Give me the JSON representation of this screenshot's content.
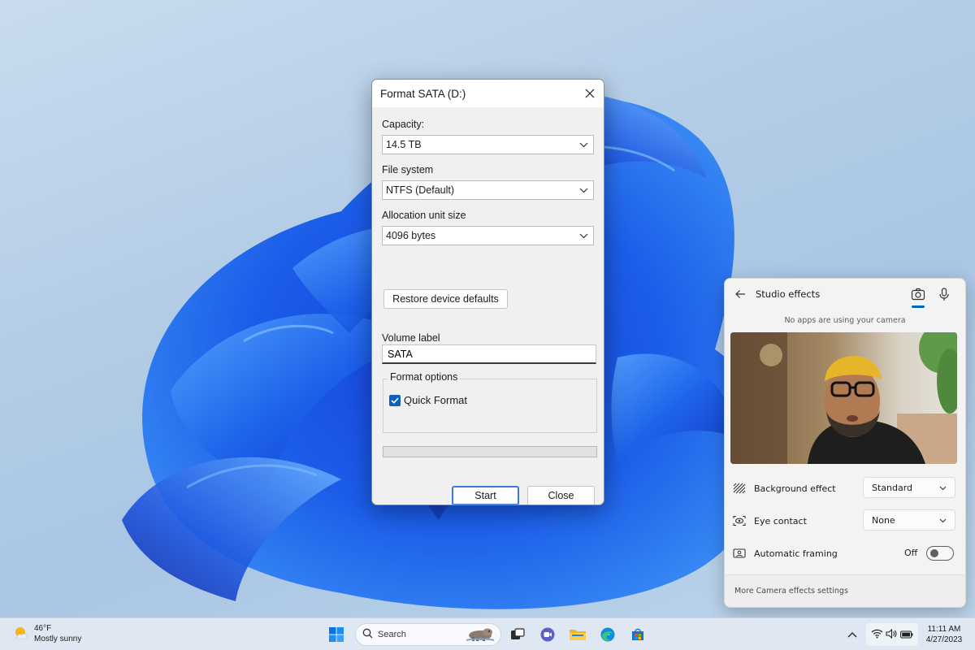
{
  "dialog": {
    "title": "Format SATA (D:)",
    "capacity_label": "Capacity:",
    "capacity_value": "14.5 TB",
    "filesystem_label": "File system",
    "filesystem_value": "NTFS (Default)",
    "allocation_label": "Allocation unit size",
    "allocation_value": "4096 bytes",
    "restore_button": "Restore device defaults",
    "volume_label": "Volume label",
    "volume_value": "SATA",
    "format_options_label": "Format options",
    "quick_format_label": "Quick Format",
    "quick_format_checked": true,
    "progress": 0,
    "start_button": "Start",
    "close_button": "Close"
  },
  "studio_effects": {
    "title": "Studio effects",
    "notice": "No apps are using your camera",
    "rows": [
      {
        "label": "Background effect",
        "value": "Standard"
      },
      {
        "label": "Eye contact",
        "value": "None"
      },
      {
        "label": "Automatic framing",
        "value": "Off"
      }
    ],
    "automatic_framing_on": false,
    "footer_link": "More Camera effects settings"
  },
  "taskbar": {
    "weather_temp": "46°F",
    "weather_desc": "Mostly sunny",
    "search_placeholder": "Search",
    "time": "11:11 AM",
    "date": "4/27/2023",
    "pinned_icons": [
      "windows-start-icon",
      "task-view-icon",
      "teams-chat-icon",
      "file-explorer-icon",
      "edge-icon",
      "store-icon"
    ],
    "accent": "#0067c0"
  }
}
